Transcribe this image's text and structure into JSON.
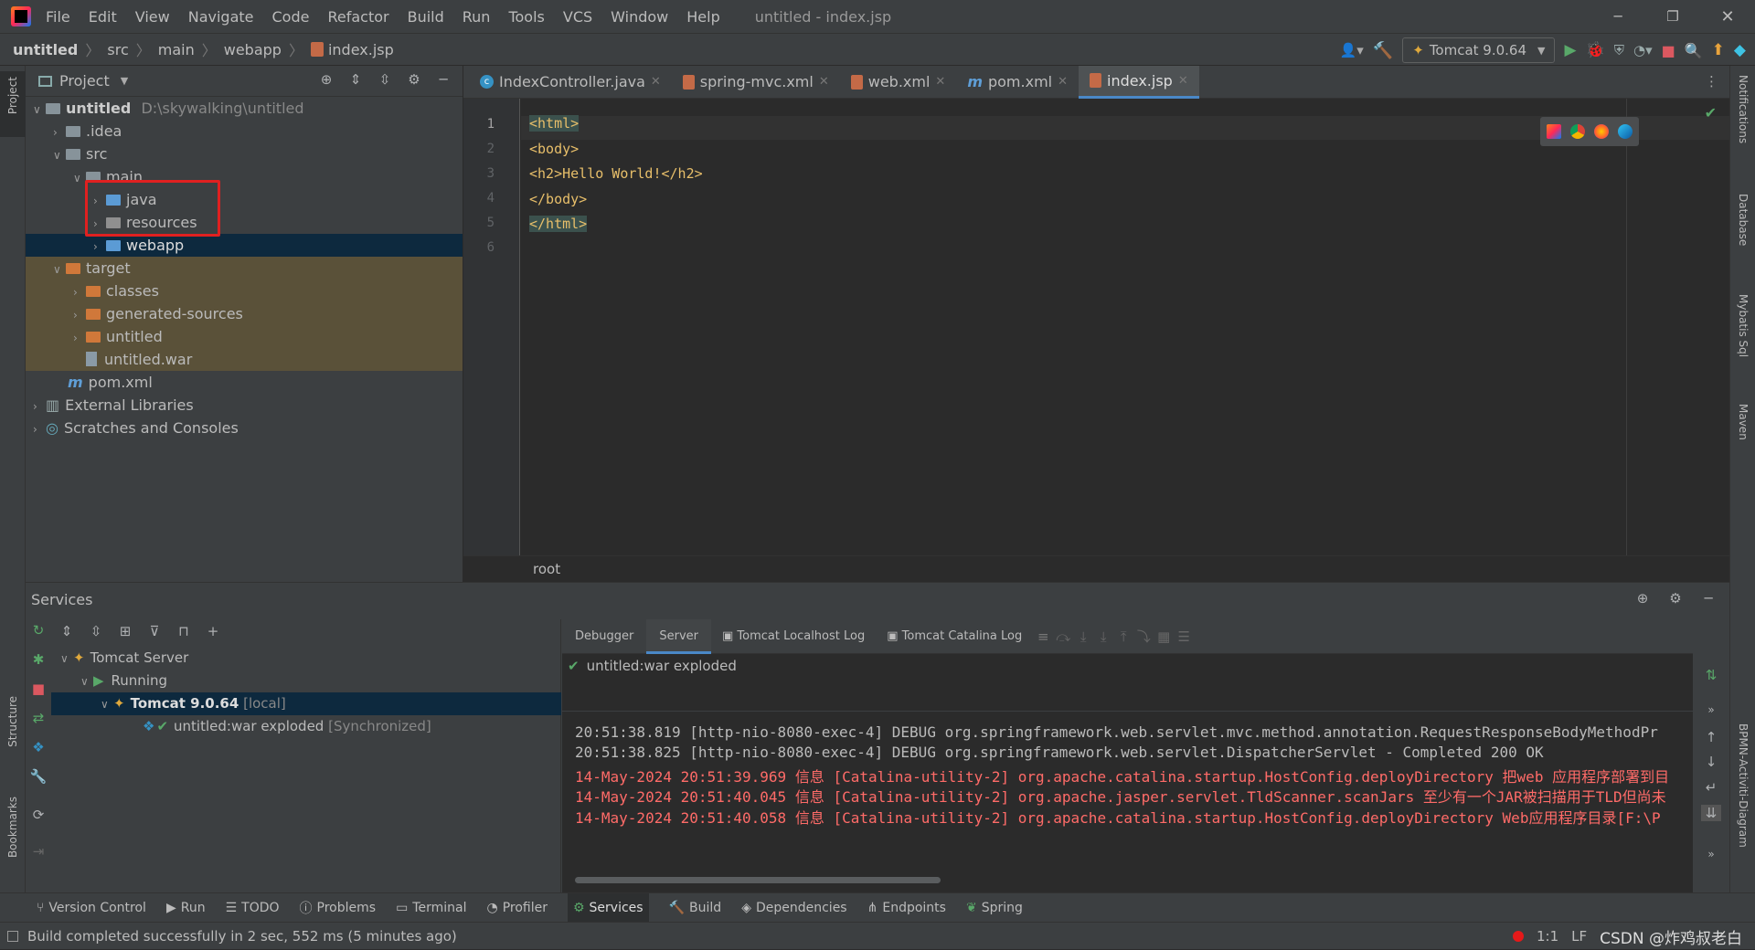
{
  "app": {
    "title": "untitled - index.jsp"
  },
  "menu": [
    "File",
    "Edit",
    "View",
    "Navigate",
    "Code",
    "Refactor",
    "Build",
    "Run",
    "Tools",
    "VCS",
    "Window",
    "Help"
  ],
  "breadcrumb": [
    "untitled",
    "src",
    "main",
    "webapp",
    "index.jsp"
  ],
  "run_config": {
    "label": "Tomcat 9.0.64"
  },
  "project_panel": {
    "title": "Project",
    "tree": [
      {
        "label": "untitled",
        "extra": "D:\\skywalking\\untitled"
      },
      {
        "label": ".idea"
      },
      {
        "label": "src"
      },
      {
        "label": "main"
      },
      {
        "label": "java"
      },
      {
        "label": "resources"
      },
      {
        "label": "webapp"
      },
      {
        "label": "target"
      },
      {
        "label": "classes"
      },
      {
        "label": "generated-sources"
      },
      {
        "label": "untitled"
      },
      {
        "label": "untitled.war"
      },
      {
        "label": "pom.xml"
      },
      {
        "label": "External Libraries"
      },
      {
        "label": "Scratches and Consoles"
      }
    ]
  },
  "editor": {
    "tabs": [
      {
        "label": "IndexController.java"
      },
      {
        "label": "spring-mvc.xml"
      },
      {
        "label": "web.xml"
      },
      {
        "label": "pom.xml"
      },
      {
        "label": "index.jsp"
      }
    ],
    "lines": [
      {
        "n": "1",
        "text": "<html>"
      },
      {
        "n": "2",
        "text": "<body>"
      },
      {
        "n": "3",
        "text": "<h2>Hello World!</h2>"
      },
      {
        "n": "4",
        "text": "</body>"
      },
      {
        "n": "5",
        "text": "</html>"
      },
      {
        "n": "6",
        "text": ""
      }
    ],
    "breadcrumb": "root"
  },
  "right_tools": [
    "Notifications",
    "Database",
    "Mybatis Sql",
    "Maven",
    "BPMN-Activiti-Diagram"
  ],
  "left_tools": [
    "Project",
    "Structure",
    "Bookmarks"
  ],
  "services": {
    "title": "Services",
    "tree": [
      {
        "label": "Tomcat Server"
      },
      {
        "label": "Running"
      },
      {
        "label": "Tomcat 9.0.64",
        "extra": "[local]"
      },
      {
        "label": "untitled:war exploded",
        "extra": "[Synchronized]"
      }
    ],
    "tabs": [
      "Debugger",
      "Server",
      "Tomcat Localhost Log",
      "Tomcat Catalina Log"
    ],
    "deployment": "untitled:war exploded",
    "log": [
      {
        "text": "20:51:38.819 [http-nio-8080-exec-4] DEBUG org.springframework.web.servlet.mvc.method.annotation.RequestResponseBodyMethodPr",
        "level": "debug"
      },
      {
        "text": "20:51:38.825 [http-nio-8080-exec-4] DEBUG org.springframework.web.servlet.DispatcherServlet - Completed 200 OK",
        "level": "debug"
      },
      {
        "text": "14-May-2024 20:51:39.969 信息 [Catalina-utility-2] org.apache.catalina.startup.HostConfig.deployDirectory 把web 应用程序部署到目",
        "level": "info"
      },
      {
        "text": "14-May-2024 20:51:40.045 信息 [Catalina-utility-2] org.apache.jasper.servlet.TldScanner.scanJars 至少有一个JAR被扫描用于TLD但尚未",
        "level": "info"
      },
      {
        "text": "14-May-2024 20:51:40.058 信息 [Catalina-utility-2] org.apache.catalina.startup.HostConfig.deployDirectory Web应用程序目录[F:\\P",
        "level": "info"
      }
    ]
  },
  "bottom_tabs": [
    "Version Control",
    "Run",
    "TODO",
    "Problems",
    "Terminal",
    "Profiler",
    "Services",
    "Build",
    "Dependencies",
    "Endpoints",
    "Spring"
  ],
  "status": {
    "message": "Build completed successfully in 2 sec, 552 ms (5 minutes ago)",
    "position": "1:1",
    "encoding": "LF",
    "watermark": "CSDN @炸鸡叔老白"
  }
}
